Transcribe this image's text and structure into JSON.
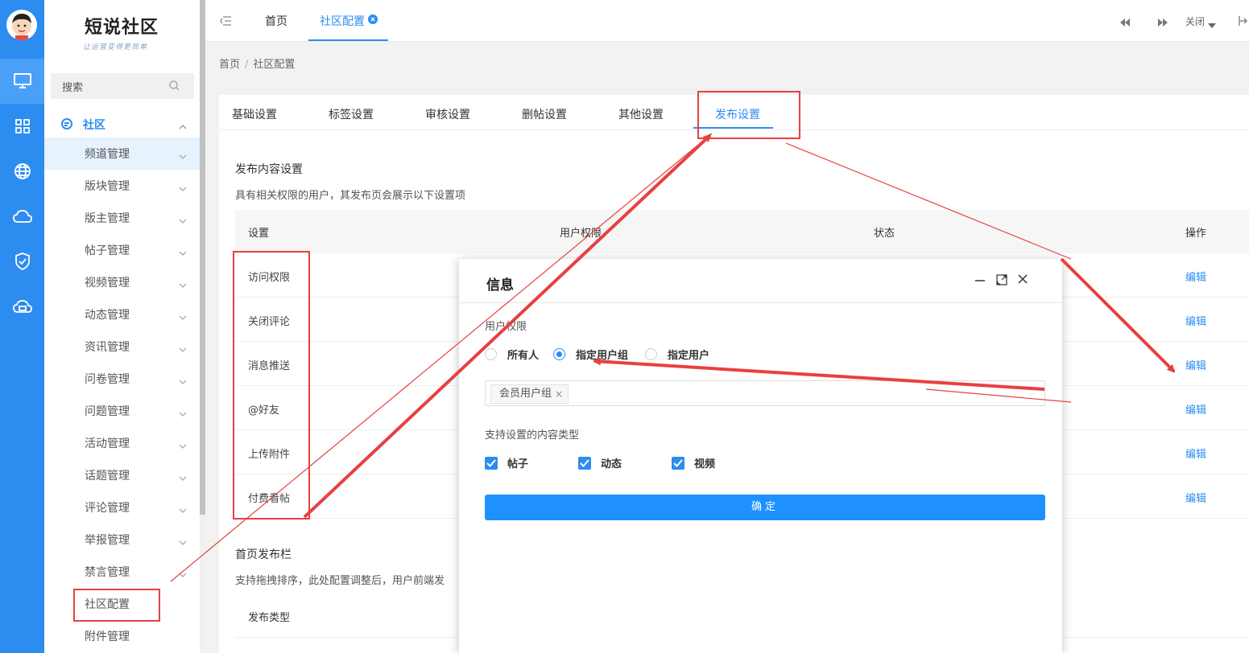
{
  "brand": {
    "logo": "短说社区",
    "slogan": "让运营变得更简单"
  },
  "sidebar": {
    "search_placeholder": "搜索",
    "group_label": "社区",
    "items": [
      {
        "label": "频道管理"
      },
      {
        "label": "版块管理"
      },
      {
        "label": "版主管理"
      },
      {
        "label": "帖子管理"
      },
      {
        "label": "视频管理"
      },
      {
        "label": "动态管理"
      },
      {
        "label": "资讯管理"
      },
      {
        "label": "问卷管理"
      },
      {
        "label": "问题管理"
      },
      {
        "label": "活动管理"
      },
      {
        "label": "话题管理"
      },
      {
        "label": "评论管理"
      },
      {
        "label": "举报管理"
      },
      {
        "label": "禁言管理"
      },
      {
        "label": "社区配置"
      },
      {
        "label": "附件管理"
      }
    ]
  },
  "topbar": {
    "tabs": [
      {
        "label": "首页"
      },
      {
        "label": "社区配置"
      }
    ],
    "close_label": "关闭"
  },
  "breadcrumb": {
    "home": "首页",
    "separator": "/",
    "current": "社区配置"
  },
  "subtabs": [
    {
      "label": "基础设置"
    },
    {
      "label": "标签设置"
    },
    {
      "label": "审核设置"
    },
    {
      "label": "删帖设置"
    },
    {
      "label": "其他设置"
    },
    {
      "label": "发布设置"
    }
  ],
  "publish_content": {
    "heading": "发布内容设置",
    "description": "具有相关权限的用户，其发布页会展示以下设置项",
    "columns": {
      "setting": "设置",
      "permission": "用户权限",
      "status": "状态",
      "action": "操作"
    },
    "rows": [
      {
        "setting": "访问权限",
        "action": "编辑"
      },
      {
        "setting": "关闭评论",
        "action": "编辑"
      },
      {
        "setting": "消息推送",
        "action": "编辑"
      },
      {
        "setting": "@好友",
        "action": "编辑"
      },
      {
        "setting": "上传附件",
        "action": "编辑"
      },
      {
        "setting": "付费看帖",
        "action": "编辑"
      }
    ]
  },
  "home_publish_bar": {
    "heading": "首页发布栏",
    "description": "支持拖拽排序，此处配置调整后，用户前端发",
    "column": "发布类型"
  },
  "modal": {
    "title": "信息",
    "permission_label": "用户权限",
    "radios": [
      {
        "label": "所有人",
        "checked": false
      },
      {
        "label": "指定用户组",
        "checked": true
      },
      {
        "label": "指定用户",
        "checked": false
      }
    ],
    "selected_tag": "会员用户组",
    "tag_remove": "×",
    "content_types_label": "支持设置的内容类型",
    "checkboxes": [
      {
        "label": "帖子",
        "checked": true
      },
      {
        "label": "动态",
        "checked": true
      },
      {
        "label": "视频",
        "checked": true
      }
    ],
    "confirm_label": "确定"
  },
  "colors": {
    "primary": "#2d8cf0",
    "annotation": "#e84040"
  }
}
